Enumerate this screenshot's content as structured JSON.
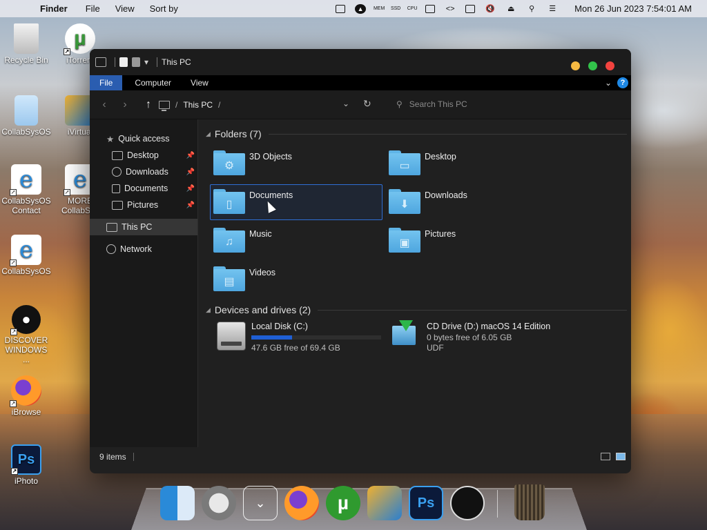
{
  "menubar": {
    "app": "Finder",
    "menus": [
      "File",
      "View",
      "Sort by"
    ],
    "status_icons": [
      "keyboard-icon",
      "eject-circle-icon",
      "mem-icon",
      "ssd-icon",
      "cpu-icon",
      "sidebar-icon",
      "code-icon",
      "display-icon",
      "mute-icon",
      "eject-icon",
      "search-icon",
      "control-center-icon"
    ],
    "mem_text": "MEM",
    "ssd_text": "SSD",
    "cpu_text": "CPU",
    "clock": "Mon 26 Jun 2023 7:54:01 AM"
  },
  "desktop": {
    "icons": [
      {
        "label": "Recycle Bin",
        "icon": "recycle-bin-icon"
      },
      {
        "label": "iTorrent",
        "icon": "utorrent-icon"
      },
      {
        "label": "CollabSysOS",
        "icon": "folder-doc-icon"
      },
      {
        "label": "iVirtual",
        "icon": "virtual-icon"
      },
      {
        "label": "CollabSysOS Contact",
        "icon": "ie-icon"
      },
      {
        "label": "MORE CollabSys",
        "icon": "ie-icon"
      },
      {
        "label": "CollabSysOS",
        "icon": "ie-icon"
      },
      {
        "label": "DISCOVER WINDOWS ...",
        "icon": "apple-icon"
      },
      {
        "label": "iBrowse",
        "icon": "firefox-icon"
      },
      {
        "label": "iPhoto",
        "icon": "photoshop-icon"
      }
    ]
  },
  "window": {
    "title": "This PC",
    "controls_colors": {
      "minimize": "#f5b942",
      "maximize": "#32c24a",
      "close": "#f2433f"
    },
    "ribbon_tabs": [
      "File",
      "Computer",
      "View"
    ],
    "help": "?",
    "address": {
      "crumb": "This PC",
      "sep": "/",
      "search_placeholder": "Search This PC"
    },
    "nav": {
      "quick_access": "Quick access",
      "pinned": [
        {
          "label": "Desktop",
          "icon": "desktop-icon"
        },
        {
          "label": "Downloads",
          "icon": "downloads-icon"
        },
        {
          "label": "Documents",
          "icon": "documents-icon"
        },
        {
          "label": "Pictures",
          "icon": "pictures-icon"
        }
      ],
      "this_pc": "This PC",
      "network": "Network"
    },
    "folders_header": "Folders (7)",
    "folders": [
      {
        "label": "3D Objects",
        "glyph": "⚙"
      },
      {
        "label": "Desktop",
        "glyph": "▭"
      },
      {
        "label": "Documents",
        "glyph": "▯"
      },
      {
        "label": "Downloads",
        "glyph": "⬇"
      },
      {
        "label": "Music",
        "glyph": "♫"
      },
      {
        "label": "Pictures",
        "glyph": "▣"
      },
      {
        "label": "Videos",
        "glyph": "▤"
      }
    ],
    "drives_header": "Devices and drives (2)",
    "drives": [
      {
        "name": "Local Disk (C:)",
        "free": "47.6 GB free of 69.4 GB",
        "used_fraction": 0.314
      },
      {
        "name": "CD Drive (D:) macOS 14 Edition",
        "free": "0 bytes free of 6.05 GB",
        "fs": "UDF"
      }
    ],
    "status": "9 items"
  },
  "dock": [
    "finder-icon",
    "launchpad-icon",
    "downloads-stack-icon",
    "firefox-icon",
    "utorrent-icon",
    "virtual-icon",
    "photoshop-icon",
    "apple-icon",
    "trash-icon"
  ]
}
